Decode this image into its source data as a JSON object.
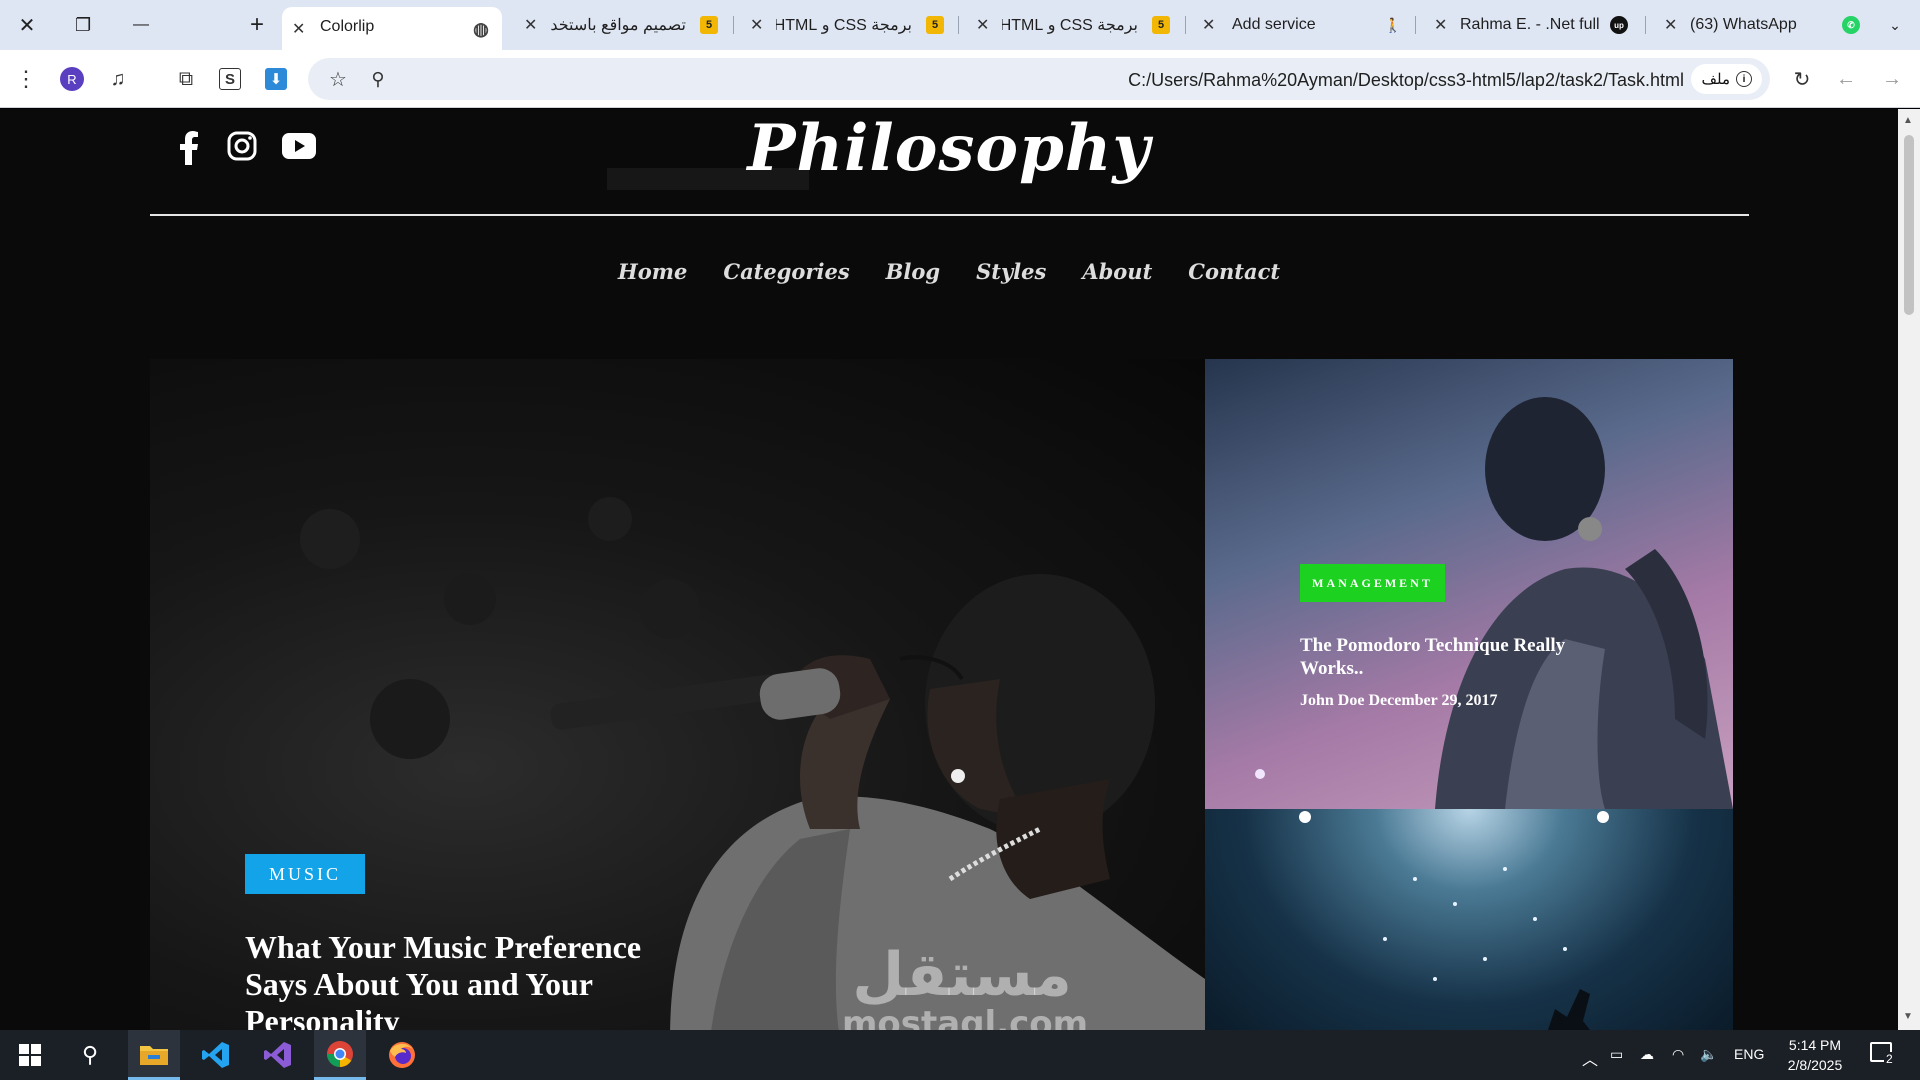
{
  "window": {
    "close": "✕",
    "restore": "❐",
    "minimize": "—",
    "new_tab": "+"
  },
  "tabs": [
    {
      "title": "(63) WhatsApp"
    },
    {
      "title": "Rahma E. - .Net full s"
    },
    {
      "title": ""
    },
    {
      "title": "Add service"
    },
    {
      "title": "برمجة CSS و HTML | -"
    },
    {
      "title": "برمجة CSS و HTML | -"
    },
    {
      "title": "تصميم مواقع باستخدا -"
    },
    {
      "title": "Colorlip"
    }
  ],
  "toolbar": {
    "url": "C:/Users/Rahma%20Ayman/Desktop/css3-html5/lap2/task2/Task.html",
    "file_chip": "ملف",
    "profile_initial": "R"
  },
  "site": {
    "logo": "Philosophy",
    "nav": [
      "Home",
      "Categories",
      "Blog",
      "Styles",
      "About",
      "Contact"
    ],
    "hero": {
      "tag": "MUSIC",
      "title_lines": [
        "What Your Music Preference",
        "Says About You and Your",
        "Personality"
      ]
    },
    "card1": {
      "tag": "MANAGEMENT",
      "title_lines": [
        "The Pomodoro Technique Really",
        "Works.."
      ],
      "meta": "John Doe December 29, 2017"
    }
  },
  "watermark": {
    "ar": "مستقل",
    "en": "mostaql.com"
  },
  "taskbar": {
    "language": "ENG",
    "time": "5:14 PM",
    "date": "2/8/2025",
    "notification_count": "2"
  },
  "colors": {
    "music_tag": "#12a3e8",
    "management_tag": "#1dd120"
  }
}
